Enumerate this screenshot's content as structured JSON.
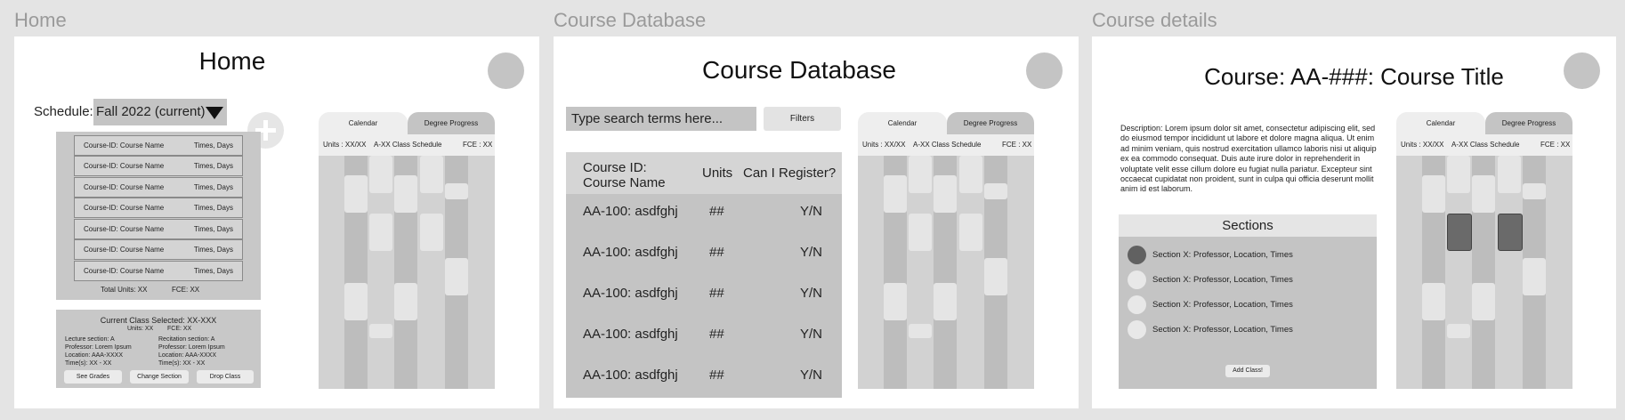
{
  "home": {
    "frame_label": "Home",
    "title": "Home",
    "schedule_label": "Schedule:",
    "schedule_value": "Fall 2022 (current)",
    "add_icon": "plus-icon",
    "courses": [
      {
        "name": "Course-ID: Course Name",
        "times": "Times, Days"
      },
      {
        "name": "Course-ID: Course Name",
        "times": "Times, Days"
      },
      {
        "name": "Course-ID: Course Name",
        "times": "Times, Days"
      },
      {
        "name": "Course-ID: Course Name",
        "times": "Times, Days"
      },
      {
        "name": "Course-ID: Course Name",
        "times": "Times, Days"
      },
      {
        "name": "Course-ID: Course Name",
        "times": "Times, Days"
      },
      {
        "name": "Course-ID: Course Name",
        "times": "Times, Days"
      }
    ],
    "total_units": "Total Units: XX",
    "total_fce": "FCE: XX",
    "selected": {
      "title": "Current Class Selected: XX-XXX",
      "units": "Units: XX",
      "fce": "FCE: XX",
      "lecture": [
        "Lecture section: A",
        "Professor: Lorem Ipsum",
        "Location: AAA-XXXX",
        "Time(s): XX - XX"
      ],
      "recitation": [
        "Recitation section: A",
        "Professor: Lorem Ipsum",
        "Location: AAA-XXXX",
        "Time(s): XX - XX"
      ],
      "buttons": {
        "grades": "See Grades",
        "change": "Change Section",
        "drop": "Drop Class"
      }
    }
  },
  "calendar": {
    "tab_calendar": "Calendar",
    "tab_degree": "Degree Progress",
    "units": "Units : XX/XX",
    "schedule": "A-XX Class Schedule",
    "fce": "FCE : XX"
  },
  "database": {
    "frame_label": "Course Database",
    "title": "Course Database",
    "search_placeholder": "Type search terms here...",
    "filters": "Filters",
    "headers": {
      "course_id": "Course ID:",
      "course_name": "Course Name",
      "units": "Units",
      "register": "Can I Register?"
    },
    "rows": [
      {
        "course": "AA-100: asdfghj",
        "units": "##",
        "register": "Y/N"
      },
      {
        "course": "AA-100: asdfghj",
        "units": "##",
        "register": "Y/N"
      },
      {
        "course": "AA-100: asdfghj",
        "units": "##",
        "register": "Y/N"
      },
      {
        "course": "AA-100: asdfghj",
        "units": "##",
        "register": "Y/N"
      },
      {
        "course": "AA-100: asdfghj",
        "units": "##",
        "register": "Y/N"
      }
    ]
  },
  "details": {
    "frame_label": "Course details",
    "title": "Course: AA-###: Course Title",
    "description": "Description: Lorem ipsum dolor sit amet, consectetur adipiscing elit, sed do eiusmod tempor incididunt ut labore et dolore magna aliqua. Ut enim ad minim veniam, quis nostrud exercitation ullamco laboris nisi ut aliquip ex ea commodo consequat. Duis aute irure dolor in reprehenderit in voluptate velit esse cillum dolore eu fugiat nulla pariatur. Excepteur sint occaecat cupidatat non proident, sunt in culpa qui officia deserunt mollit anim id est laborum.",
    "sections_title": "Sections",
    "sections": [
      {
        "label": "Section X: Professor, Location, Times",
        "selected": true
      },
      {
        "label": "Section X: Professor, Location, Times",
        "selected": false
      },
      {
        "label": "Section X: Professor, Location, Times",
        "selected": false
      },
      {
        "label": "Section X: Professor, Location, Times",
        "selected": false
      }
    ],
    "add_button": "Add Class!"
  }
}
